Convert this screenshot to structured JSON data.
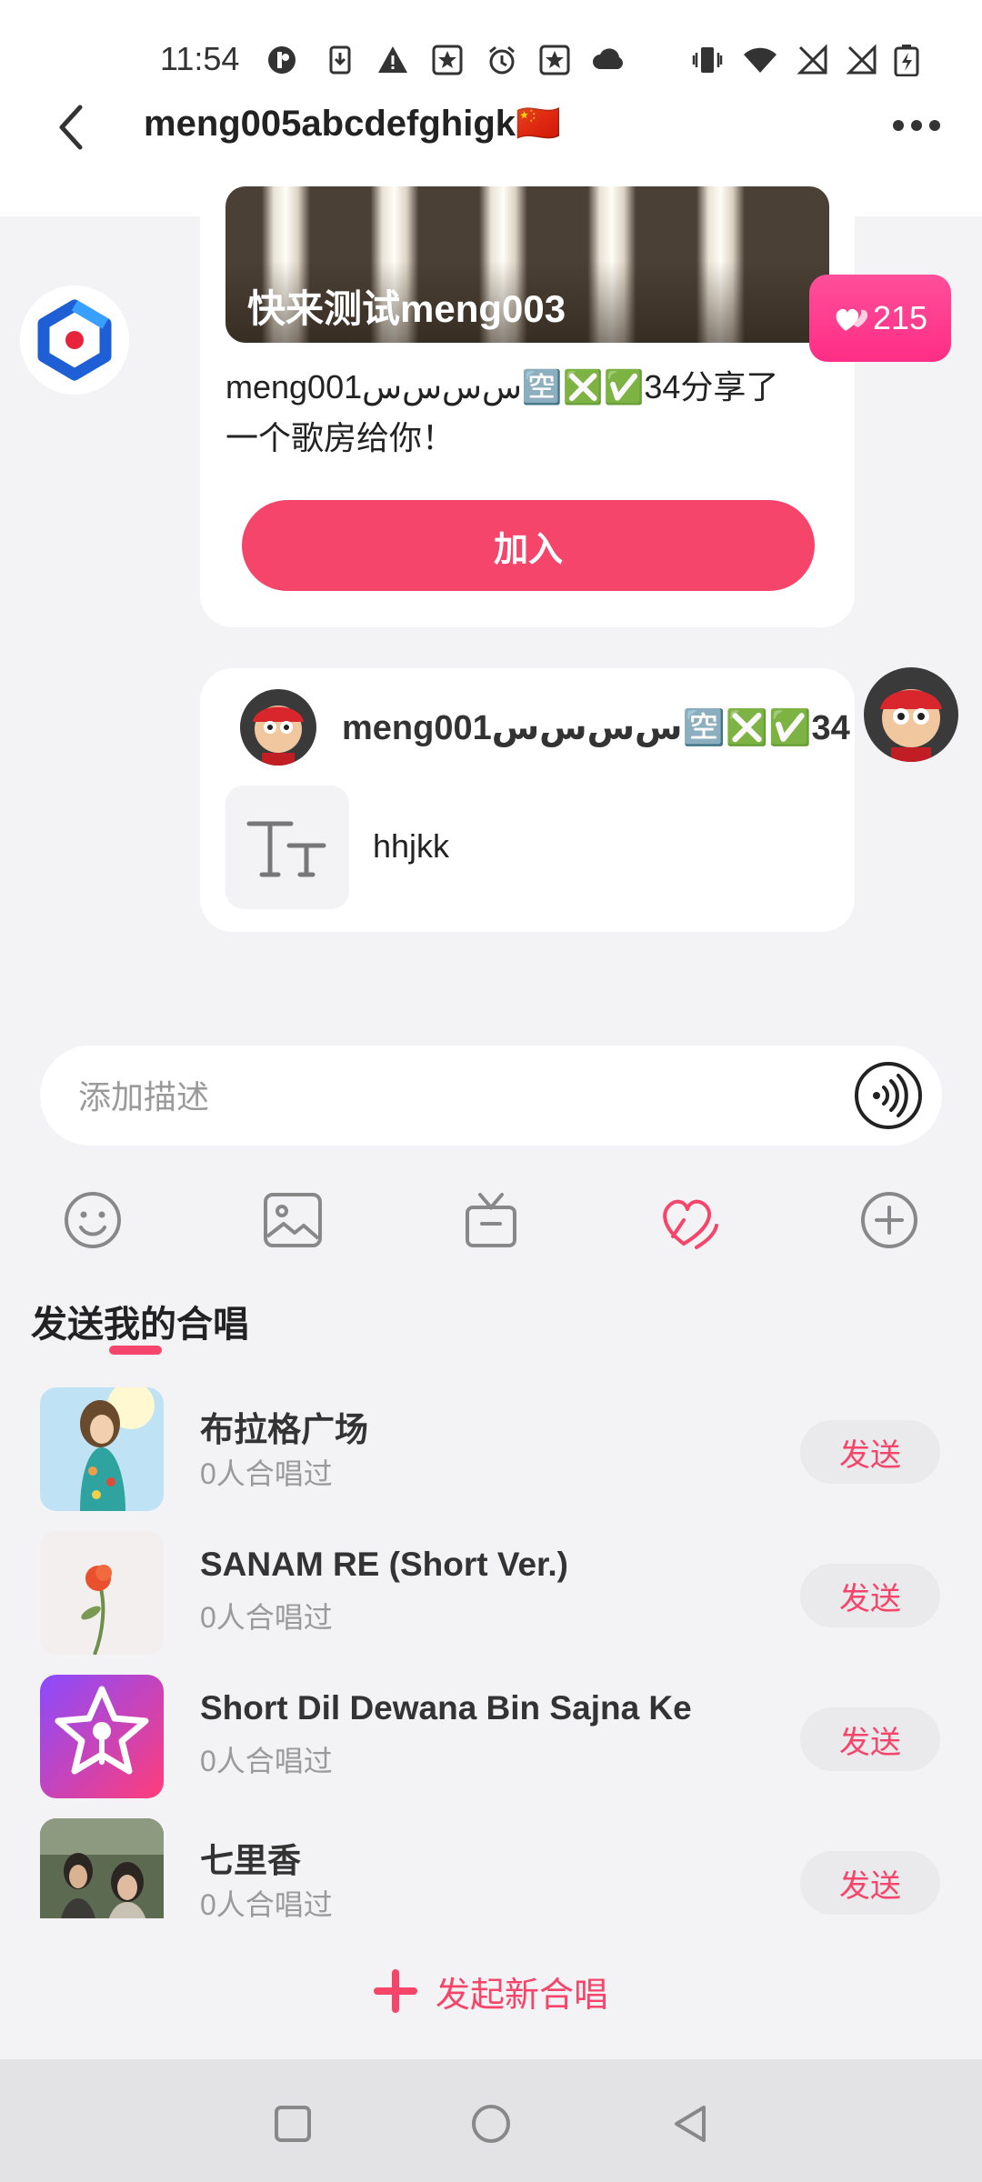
{
  "status_bar": {
    "time": "11:54",
    "left_icons": [
      "app-notification-icon",
      "download-icon",
      "warning-icon",
      "star-badge-icon",
      "alarm-icon",
      "star-badge-icon",
      "cloud-icon"
    ],
    "right_icons": [
      "vibrate-icon",
      "wifi-icon",
      "no-signal-icon",
      "no-signal-icon",
      "battery-charging-icon"
    ]
  },
  "header": {
    "title": "meng005abcdefghigk🇨🇳",
    "back_icon": "chevron-left-icon",
    "more_icon": "more-dots-icon"
  },
  "room_share": {
    "room_title": "快来测试meng003",
    "likes": "215",
    "message": "meng001ﺱﺱﺱﺱ🈳❎✅34分享了一个歌房给你！",
    "join_label": "加入"
  },
  "text_message": {
    "username": "meng001ﺱﺱﺱﺱ🈳❎✅34",
    "content": "hhjkk",
    "type_icon": "text-type-icon"
  },
  "input": {
    "placeholder": "添加描述",
    "voice_icon": "voice-wave-icon"
  },
  "toolbar": {
    "items": [
      "emoji-icon",
      "image-icon",
      "gift-icon",
      "duet-heart-icon",
      "plus-circle-icon"
    ]
  },
  "section": {
    "title": "发送我的合唱"
  },
  "songs": [
    {
      "title": "布拉格广场",
      "sub": "0人合唱过",
      "send": "发送"
    },
    {
      "title": "SANAM RE (Short Ver.)",
      "sub": "0人合唱过",
      "send": "发送"
    },
    {
      "title": "Short Dil Dewana Bin Sajna Ke",
      "sub": "0人合唱过",
      "send": "发送"
    },
    {
      "title": "七里香",
      "sub": "0人合唱过",
      "send": "发送"
    }
  ],
  "new_duet": {
    "label": "发起新合唱"
  },
  "colors": {
    "accent": "#f5456a",
    "badge_pink": "#ff3d8f",
    "background": "#f3f3f5"
  }
}
